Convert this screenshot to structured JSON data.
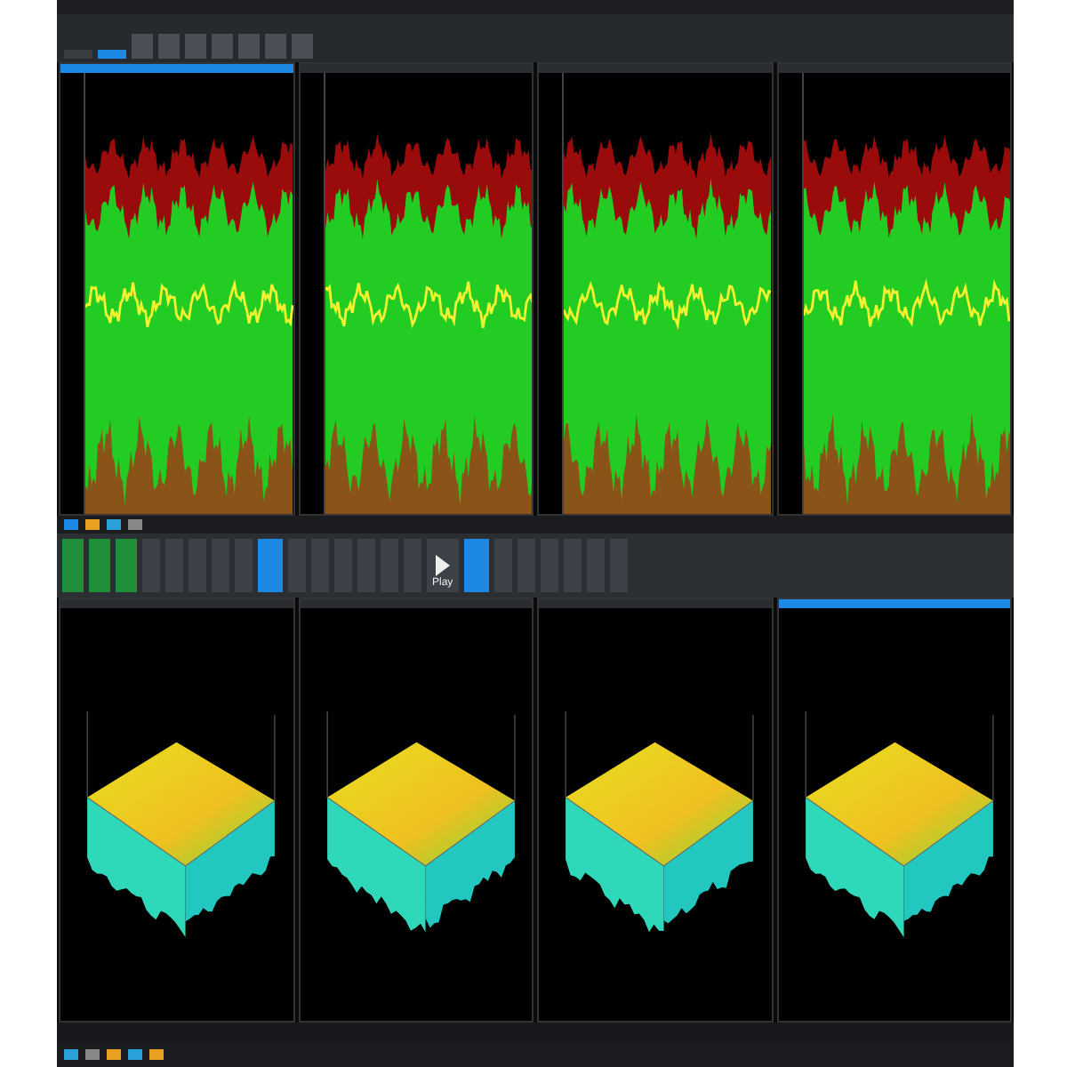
{
  "ribbon_tabs": [
    {
      "selected": false
    },
    {
      "selected": true
    }
  ],
  "top_panels": [
    {
      "selected": true
    },
    {
      "selected": false
    },
    {
      "selected": false
    },
    {
      "selected": false
    }
  ],
  "toolbar": {
    "play_label": "Play"
  },
  "bottom_panels": [
    {
      "selected": false
    },
    {
      "selected": false
    },
    {
      "selected": false
    },
    {
      "selected": true
    }
  ]
}
